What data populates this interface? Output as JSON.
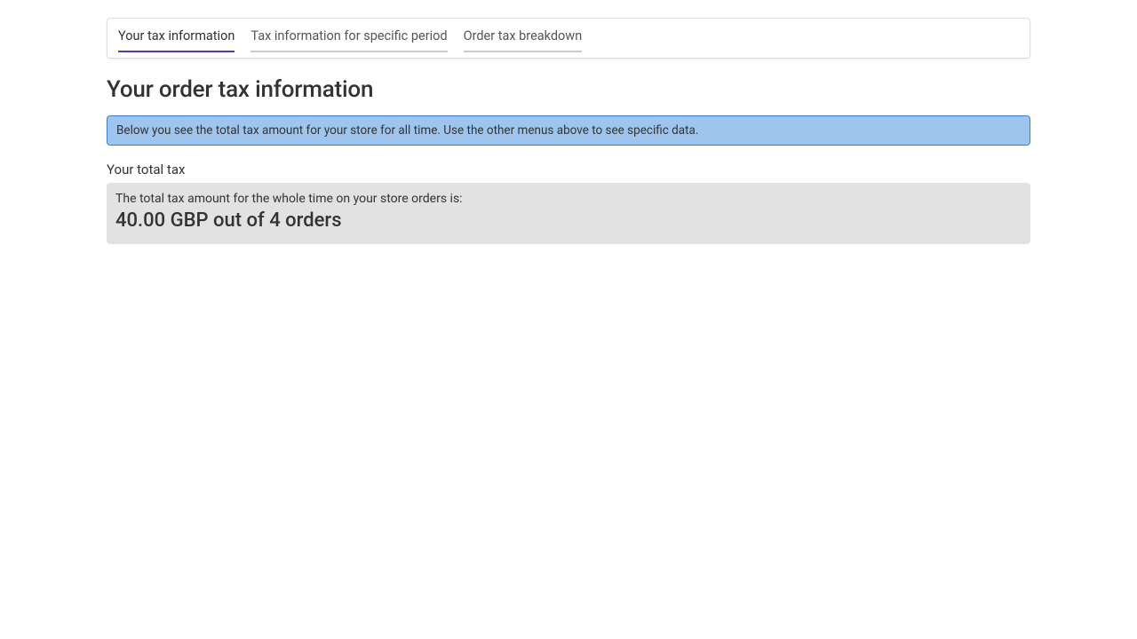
{
  "tabs": {
    "items": [
      {
        "label": "Your tax information",
        "active": true
      },
      {
        "label": "Tax information for specific period",
        "active": false
      },
      {
        "label": "Order tax breakdown",
        "active": false
      }
    ]
  },
  "page_title": "Your order tax information",
  "info_banner": "Below you see the total tax amount for your store for all time. Use the other menus above to see specific data.",
  "total_section": {
    "label": "Your total tax",
    "caption": "The total tax amount for the whole time on your store orders is:",
    "value": "40.00 GBP out of 4 orders"
  }
}
